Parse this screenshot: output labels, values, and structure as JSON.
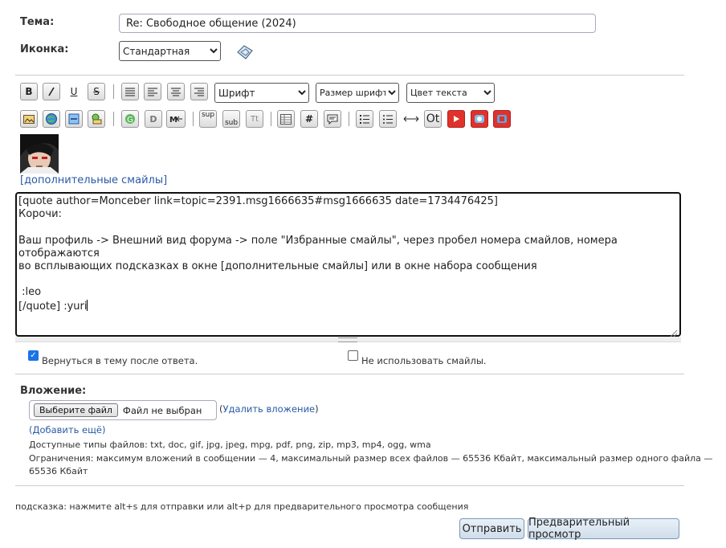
{
  "subject": {
    "label": "Тема:",
    "value": "Re: Свободное общение (2024)"
  },
  "icon_row": {
    "label": "Иконка:",
    "selected": "Стандартная"
  },
  "toolbar": {
    "bold": "B",
    "italic": "I",
    "underline": "U",
    "strike": "S",
    "font_select": "Шрифт",
    "size_select": "Размер шрифта",
    "color_select": "Цвет текста",
    "sup": "sup",
    "sub": "sub",
    "tt": "Tt",
    "hash": "#",
    "ot": "Ot"
  },
  "smileys_link": "[дополнительные смайлы]",
  "message": {
    "line1": "[quote author=Monceber link=topic=2391.msg1666635#msg1666635 date=1734476425]",
    "line2": "Корочи:",
    "line3": "",
    "line4": "Ваш профиль -> Внешний вид форума -> поле \"Избранные смайлы\", через пробел номера смайлов, номера отображаются",
    "line5": "во всплывающих подсказках в окне [дополнительные смайлы] или в окне набора сообщения",
    "line6": "",
    "line7": " :leo",
    "line8": "[/quote] :yuri"
  },
  "options": {
    "return_label": "Вернуться в тему после ответа.",
    "return_checked": true,
    "nosmileys_label": "Не использовать смайлы.",
    "nosmileys_checked": false
  },
  "attachment": {
    "label": "Вложение:",
    "choose_button": "Выберите файл",
    "no_file": "Файл не выбран",
    "paren_open": "(",
    "remove_link": "Удалить вложение",
    "paren_close": ")",
    "add_more": "(Добавить ещё)",
    "allowed_types": "Доступные типы файлов: txt, doc, gif, jpg, jpeg, mpg, pdf, png, zip, mp3, mp4, ogg, wma",
    "limits_line1": "Ограничения: максимум вложений в сообщении — 4, максимальный размер всех файлов — 65536 Кбайт, максимальный размер одного файла —",
    "limits_line2": "65536 Кбайт"
  },
  "hint": "подсказка: нажмите alt+s для отправки или alt+p для предварительного просмотра сообщения",
  "buttons": {
    "send": "Отправить",
    "preview": "Предварительный просмотр"
  },
  "colors": {
    "link": "#2a5aa6",
    "accent_checkbox": "#1a73e8",
    "youtube_red": "#e0322b"
  }
}
